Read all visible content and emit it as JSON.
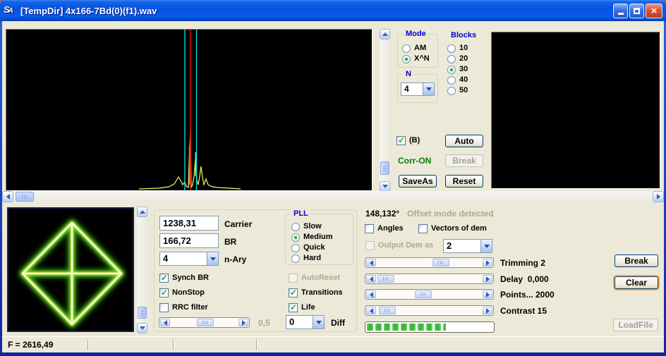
{
  "window": {
    "title": "[TempDir] 4x166-7Bd(0)(f1).wav",
    "icon_text": "SA"
  },
  "top_panel": {
    "mode_group": {
      "label": "Mode",
      "options": [
        {
          "label": "AM",
          "selected": false
        },
        {
          "label": "X^N",
          "selected": true
        }
      ]
    },
    "n_group": {
      "label": "N",
      "value": "4"
    },
    "blocks_group": {
      "label": "Blocks",
      "options": [
        {
          "label": "10",
          "selected": false
        },
        {
          "label": "20",
          "selected": false
        },
        {
          "label": "30",
          "selected": true
        },
        {
          "label": "40",
          "selected": false
        },
        {
          "label": "50",
          "selected": false
        }
      ]
    },
    "b_checkbox": {
      "label": "(B)",
      "checked": true
    },
    "auto_button": "Auto",
    "corr_status": "Corr-ON",
    "break_button": "Break",
    "saveas_button": "SaveAs",
    "reset_button": "Reset"
  },
  "demod_panel": {
    "carrier": {
      "value": "1238,31",
      "label": "Carrier"
    },
    "br": {
      "value": "166,72",
      "label": "BR"
    },
    "n_ary": {
      "value": "4",
      "label": "n-Ary"
    },
    "pll_group": {
      "label": "PLL",
      "options": [
        {
          "label": "Slow",
          "selected": false
        },
        {
          "label": "Medium",
          "selected": true
        },
        {
          "label": "Quick",
          "selected": false
        },
        {
          "label": "Hard",
          "selected": false
        }
      ]
    },
    "synch_br": {
      "label": "Synch BR",
      "checked": true
    },
    "nonstop": {
      "label": "NonStop",
      "checked": true
    },
    "rrc_filter": {
      "label": "RRC filter",
      "checked": false
    },
    "autoreset": {
      "label": "AutoReset",
      "checked": false,
      "disabled": true
    },
    "transitions": {
      "label": "Transitions",
      "checked": true
    },
    "life": {
      "label": "Life",
      "checked": true
    },
    "rrc_slider_value": "0,5",
    "diff": {
      "value": "0",
      "label": "Diff"
    }
  },
  "analysis_panel": {
    "offset_value": "148,132°",
    "offset_status": "Offset mode detected",
    "angles": {
      "label": "Angles",
      "checked": false
    },
    "vectors_of_dem": {
      "label": "Vectors of dem",
      "checked": false
    },
    "output_dem": {
      "label": "Output Dem as",
      "value": "2",
      "disabled": true
    },
    "sliders": [
      {
        "label": "Trimming 2"
      },
      {
        "label": "Delay  0,000"
      },
      {
        "label": "Points... 2000"
      },
      {
        "label": "Contrast 15"
      }
    ],
    "progress_percent": 63,
    "break_button": "Break",
    "clear_button": "Clear",
    "loadfile_button": "LoadFile"
  },
  "status_bar": {
    "field1": "F = 2616,49"
  },
  "colors": {
    "accent_blue": "#0000d4",
    "status_green": "#008000",
    "check_green": "#21a121",
    "progress_green": "#46c33e",
    "display_bg": "#000000",
    "marker_red": "#cc1111",
    "marker_cyan": "#00d8d8",
    "trace_yellow": "#f4f46a",
    "constellation_green": "#7fd41e"
  }
}
